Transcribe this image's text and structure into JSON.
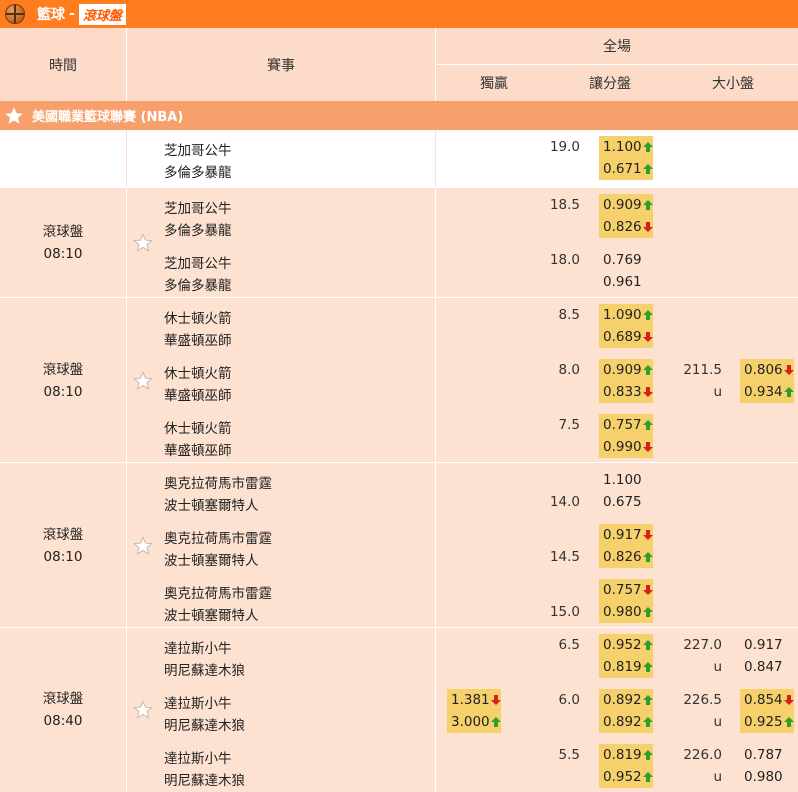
{
  "titlebar": {
    "sport": "籃球",
    "separator": "-",
    "tag": "滾球盤"
  },
  "header": {
    "time": "時間",
    "event": "賽事",
    "fulltime": "全場",
    "moneyline": "獨贏",
    "handicap": "讓分盤",
    "overunder": "大小盤"
  },
  "league": {
    "name": "美國職業籃球聯賽 (NBA)"
  },
  "colors": {
    "orange": "#ff7c1f",
    "highlight": "#f6d06a",
    "up": "#2e9e2e",
    "down": "#d62020"
  },
  "groups": [
    {
      "live": "",
      "time": "",
      "markets": [
        {
          "home": "芝加哥公牛",
          "away": "多倫多暴龍",
          "hcp_line": "19.0",
          "hcp_home": "1.100",
          "hcp_away": "0.671",
          "hcp_home_dir": "up",
          "hcp_away_dir": "up"
        }
      ]
    },
    {
      "live": "滾球盤",
      "time": "08:10",
      "markets": [
        {
          "home": "芝加哥公牛",
          "away": "多倫多暴龍",
          "hcp_line": "18.5",
          "hcp_home": "0.909",
          "hcp_away": "0.826",
          "hcp_home_dir": "up",
          "hcp_away_dir": "down"
        },
        {
          "home": "芝加哥公牛",
          "away": "多倫多暴龍",
          "hcp_line": "18.0",
          "hcp_home": "0.769",
          "hcp_away": "0.961",
          "hcp_home_dir": "",
          "hcp_away_dir": ""
        }
      ]
    },
    {
      "live": "滾球盤",
      "time": "08:10",
      "markets": [
        {
          "home": "休士頓火箭",
          "away": "華盛頓巫師",
          "hcp_line": "8.5",
          "hcp_home": "1.090",
          "hcp_away": "0.689",
          "hcp_home_dir": "up",
          "hcp_away_dir": "down"
        },
        {
          "home": "休士頓火箭",
          "away": "華盛頓巫師",
          "hcp_line": "8.0",
          "hcp_home": "0.909",
          "hcp_away": "0.833",
          "hcp_home_dir": "up",
          "hcp_away_dir": "down",
          "ou_line": "211.5",
          "ou_under": "u",
          "ou_over_odds": "0.806",
          "ou_under_odds": "0.934",
          "ou_over_dir": "down",
          "ou_under_dir": "up"
        },
        {
          "home": "休士頓火箭",
          "away": "華盛頓巫師",
          "hcp_line": "7.5",
          "hcp_home": "0.757",
          "hcp_away": "0.990",
          "hcp_home_dir": "up",
          "hcp_away_dir": "down"
        }
      ]
    },
    {
      "live": "滾球盤",
      "time": "08:10",
      "markets": [
        {
          "home": "奧克拉荷馬市雷霆",
          "away": "波士頓塞爾特人",
          "hcp_line": "14.0",
          "hcp_line_pos": "away",
          "hcp_home": "1.100",
          "hcp_away": "0.675",
          "hcp_home_dir": "",
          "hcp_away_dir": ""
        },
        {
          "home": "奧克拉荷馬市雷霆",
          "away": "波士頓塞爾特人",
          "hcp_line": "14.5",
          "hcp_line_pos": "away",
          "hcp_home": "0.917",
          "hcp_away": "0.826",
          "hcp_home_dir": "down",
          "hcp_away_dir": "up"
        },
        {
          "home": "奧克拉荷馬市雷霆",
          "away": "波士頓塞爾特人",
          "hcp_line": "15.0",
          "hcp_line_pos": "away",
          "hcp_home": "0.757",
          "hcp_away": "0.980",
          "hcp_home_dir": "down",
          "hcp_away_dir": "up"
        }
      ]
    },
    {
      "live": "滾球盤",
      "time": "08:40",
      "markets": [
        {
          "home": "達拉斯小牛",
          "away": "明尼蘇達木狼",
          "hcp_line": "6.5",
          "hcp_home": "0.952",
          "hcp_away": "0.819",
          "hcp_home_dir": "up",
          "hcp_away_dir": "up",
          "ou_line": "227.0",
          "ou_under": "u",
          "ou_over_odds": "0.917",
          "ou_under_odds": "0.847",
          "ou_over_dir": "",
          "ou_under_dir": ""
        },
        {
          "home": "達拉斯小牛",
          "away": "明尼蘇達木狼",
          "ml_home": "1.381",
          "ml_away": "3.000",
          "ml_home_dir": "down",
          "ml_away_dir": "up",
          "hcp_line": "6.0",
          "hcp_home": "0.892",
          "hcp_away": "0.892",
          "hcp_home_dir": "up",
          "hcp_away_dir": "up",
          "ou_line": "226.5",
          "ou_under": "u",
          "ou_over_odds": "0.854",
          "ou_under_odds": "0.925",
          "ou_over_dir": "down",
          "ou_under_dir": "up"
        },
        {
          "home": "達拉斯小牛",
          "away": "明尼蘇達木狼",
          "hcp_line": "5.5",
          "hcp_home": "0.819",
          "hcp_away": "0.952",
          "hcp_home_dir": "up",
          "hcp_away_dir": "up",
          "ou_line": "226.0",
          "ou_under": "u",
          "ou_over_odds": "0.787",
          "ou_under_odds": "0.980",
          "ou_over_dir": "",
          "ou_under_dir": ""
        }
      ]
    }
  ]
}
